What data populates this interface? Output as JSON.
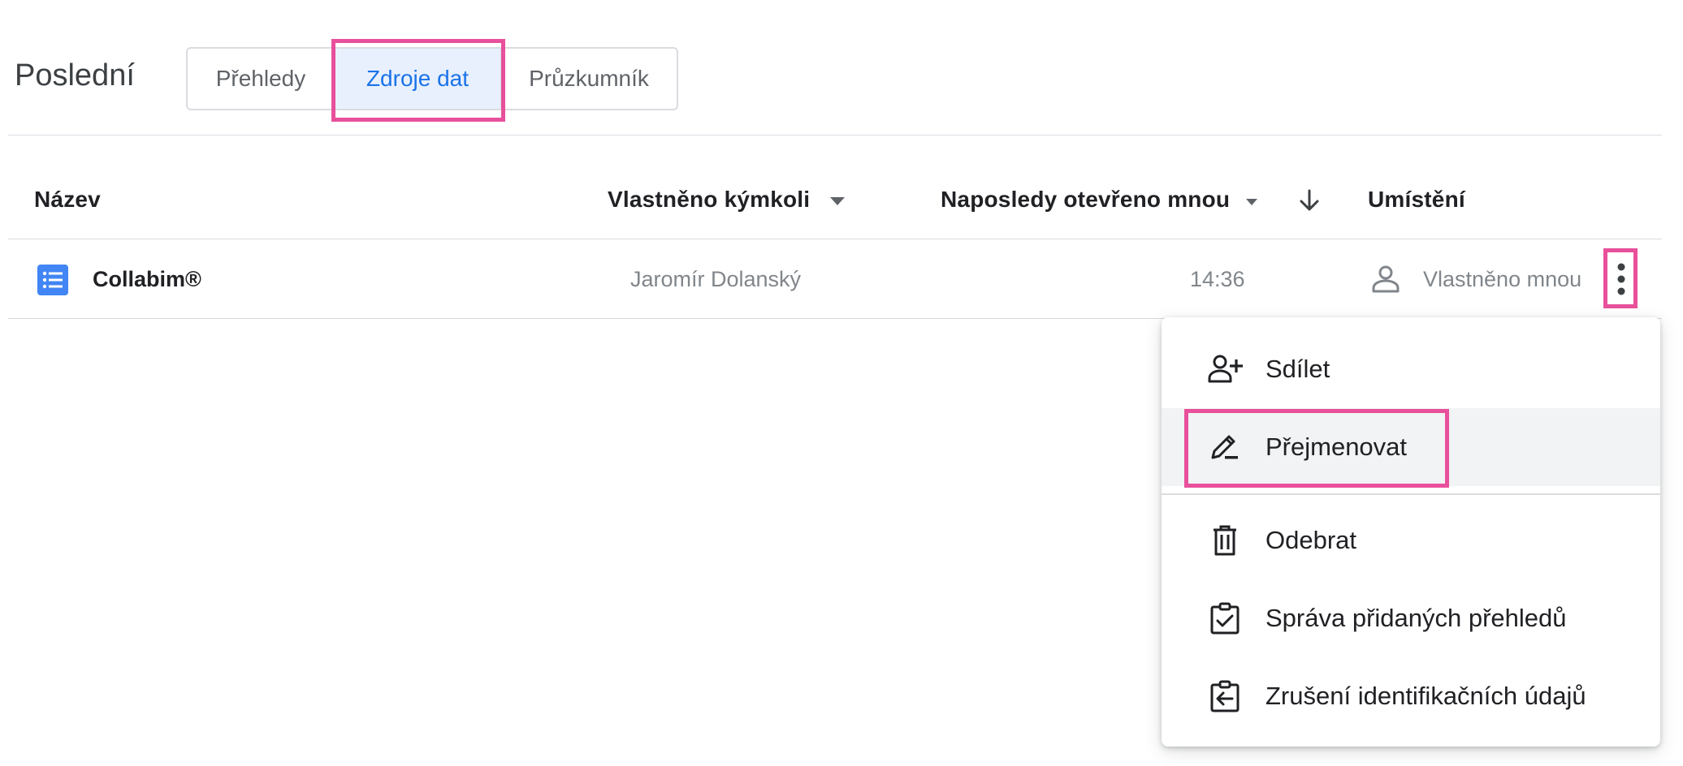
{
  "header": {
    "title": "Poslední"
  },
  "tabs": [
    {
      "label": "Přehledy",
      "active": false
    },
    {
      "label": "Zdroje dat",
      "active": true
    },
    {
      "label": "Průzkumník",
      "active": false
    }
  ],
  "table": {
    "columns": {
      "name": "Název",
      "owner": "Vlastněno kýmkoli",
      "opened": "Naposledy otevřeno mnou",
      "location": "Umístění"
    },
    "sort_icon": "arrow-down-icon",
    "rows": [
      {
        "icon": "list-document-icon",
        "name": "Collabim®",
        "owner": "Jaromír Dolanský",
        "opened": "14:36",
        "location_icon": "person-icon",
        "location": "Vlastněno mnou",
        "more_icon": "more-vert-icon"
      }
    ]
  },
  "context_menu": {
    "items": [
      {
        "icon": "person-add-icon",
        "label": "Sdílet"
      },
      {
        "icon": "edit-icon",
        "label": "Přejmenovat"
      },
      {
        "icon": "trash-icon",
        "label": "Odebrat"
      },
      {
        "icon": "clipboard-check-icon",
        "label": "Správa přidaných přehledů"
      },
      {
        "icon": "clipboard-arrow-icon",
        "label": "Zrušení identifikačních údajů"
      }
    ]
  },
  "colors": {
    "accent": "#1a73e8",
    "active_tab_bg": "#e8f0fe",
    "highlight": "#e8509b",
    "menu_hover": "#f1f3f4"
  }
}
